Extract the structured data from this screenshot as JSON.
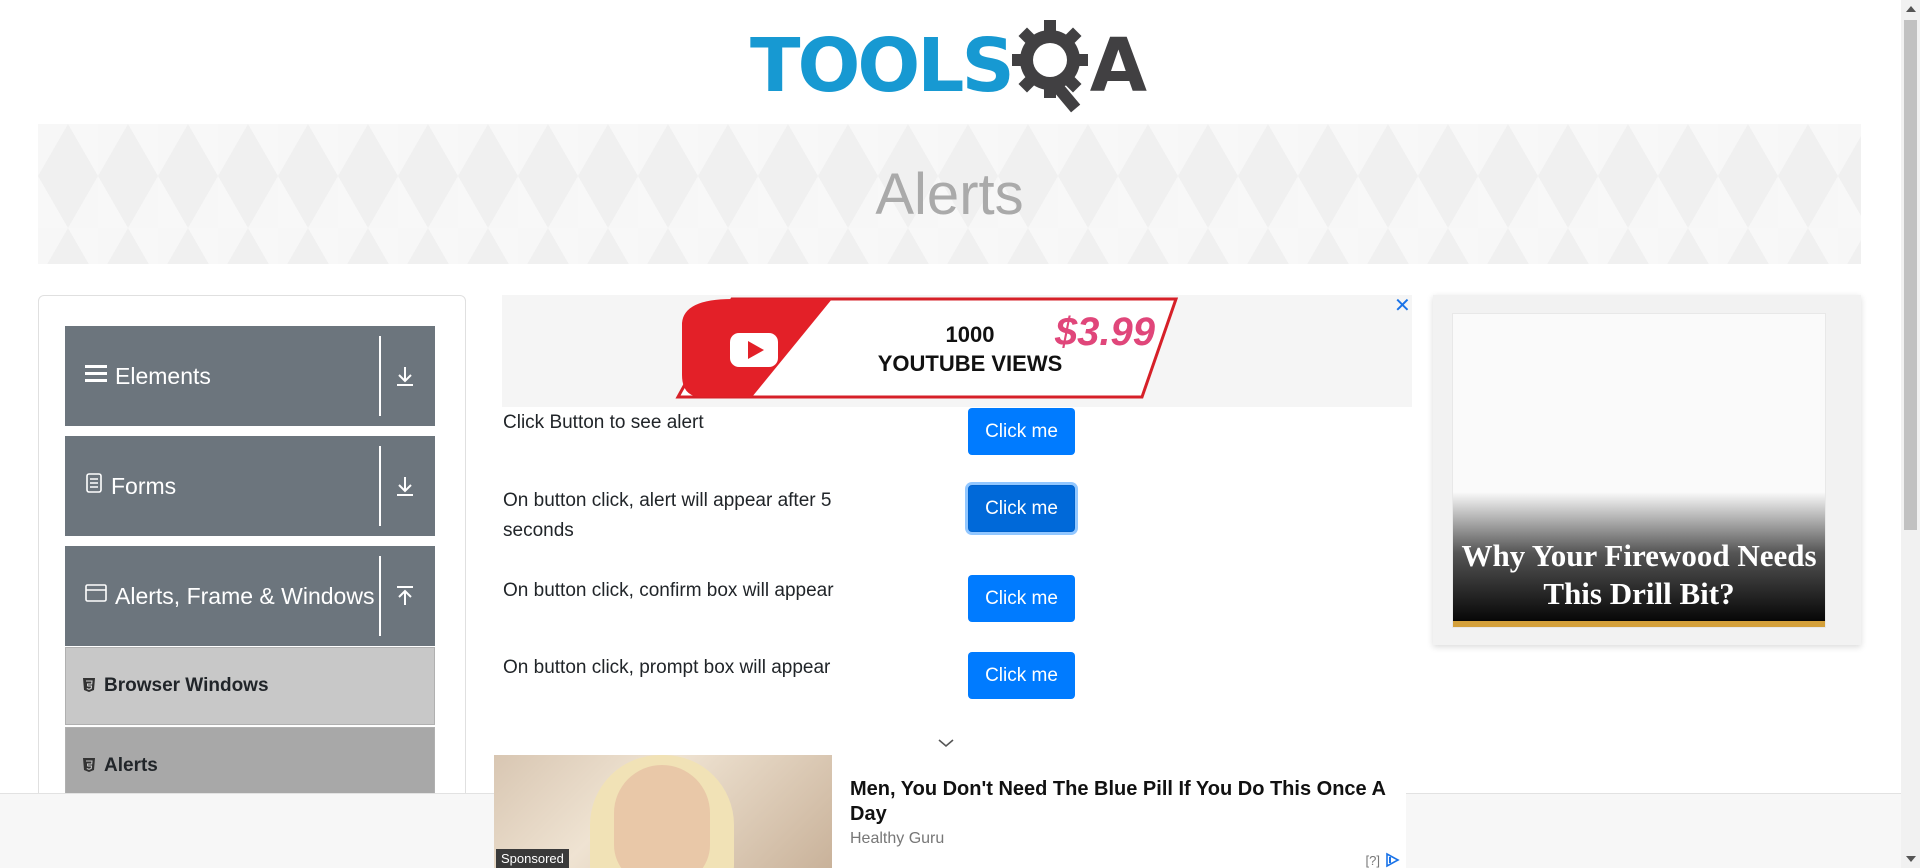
{
  "logo": {
    "part1": "TOOLS",
    "part2": "A"
  },
  "banner": {
    "title": "Alerts"
  },
  "sidebar": {
    "groups": [
      {
        "label": "Elements",
        "icon": "hamburger-icon",
        "state": "collapsed"
      },
      {
        "label": "Forms",
        "icon": "document-icon",
        "state": "collapsed"
      },
      {
        "label": "Alerts, Frame & Windows",
        "icon": "window-icon",
        "state": "expanded"
      }
    ],
    "items": [
      {
        "label": "Browser Windows",
        "icon": "html5-icon"
      },
      {
        "label": "Alerts",
        "icon": "html5-icon"
      }
    ]
  },
  "ad_top": {
    "views": "1000",
    "views_unit": "YOUTUBE VIEWS",
    "price": "$3.99",
    "close": "✕"
  },
  "alerts": {
    "rows": [
      {
        "label": "Click Button to see alert",
        "button": "Click me"
      },
      {
        "label": "On button click, alert will appear after 5 seconds",
        "button": "Click me"
      },
      {
        "label": "On button click, confirm box will appear",
        "button": "Click me"
      },
      {
        "label": "On button click, prompt box will appear",
        "button": "Click me"
      }
    ]
  },
  "ad_right": {
    "headline": "Why Your Firewood Needs This Drill Bit?"
  },
  "sponsored": {
    "tag": "Sponsored",
    "title": "Men, You Don't Need The Blue Pill If You Do This Once A Day",
    "source": "Healthy Guru",
    "adchoice": "[?]"
  },
  "colors": {
    "primary": "#007bff",
    "sidebar": "#6c757d",
    "logo_blue": "#1799d2",
    "logo_dark": "#414042"
  }
}
